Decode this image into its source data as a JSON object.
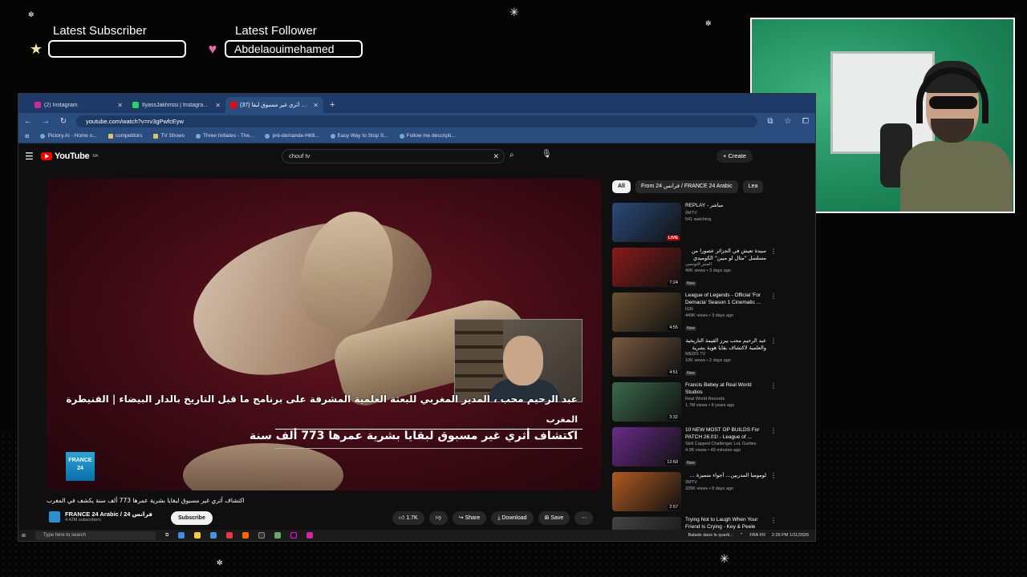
{
  "overlay": {
    "subscriber_label": "Latest Subscriber",
    "subscriber_value": "",
    "follower_label": "Latest Follower",
    "follower_value": "Abdelaouimehamed"
  },
  "browser": {
    "tabs": [
      {
        "title": "(2) Instagram",
        "color": "#d6249f"
      },
      {
        "title": "IlyassJakhrissi | Instagram, Face",
        "color": "#25d366"
      },
      {
        "title": "(37) اكتشاف أثري غير مسبوق لبقا",
        "color": "#ff0000"
      }
    ],
    "url": "youtube.com/watch?v=rv3gPwfcEyw",
    "bookmarks": [
      "Pictory.AI - Home o...",
      "competitors",
      "TV Shows",
      "Three Initiates - The...",
      "pré-demande-H69...",
      "Easy Way to Stop S...",
      "Follow me descripti..."
    ]
  },
  "youtube": {
    "logo": "YouTube",
    "logo_region": "MA",
    "search_query": "chouf tv",
    "create_label": "Create",
    "video": {
      "overlay_line1": "عبد الرحيم محب ، المدير المغربي للبعثة العلمية المشرفة على برنامج ما قبل التاريخ بالدار البيضاء | القنيطرة",
      "overlay_line2": "المغرب",
      "overlay_headline": "اكتشاف أثري غير مسبوق لبقايا بشرية عمرها 773 ألف سنة",
      "logo_text": "FRANCE 24",
      "title": "اكتشاف أثري غير مسبوق لبقايا بشرية عمرها 773 ألف سنة يكشف في المغرب",
      "channel": "FRANCE 24 Arabic / فرانس 24",
      "subscribers": "4.42M subscribers",
      "subscribe": "Subscribe",
      "likes": "1.7K",
      "share": "Share",
      "download": "Download",
      "save": "Save"
    },
    "chips": [
      "All",
      "From فرانس 24 / FRANCE 24 Arabic",
      "Lea"
    ],
    "recommendations": [
      {
        "title": "REPLAY - مباشر",
        "channel": "2MTV",
        "meta": "541 watching",
        "badge": "LIVE",
        "isnew": "",
        "rtl": false,
        "color": "#2b4a7a"
      },
      {
        "title": "سيدة تعيش في الجزائر عصورا من مسلسل \"مثال لو مبين\" الكوميدي لتبدل الحالة ...",
        "channel": "المنبر التونسي",
        "meta": "49K views • 3 days ago",
        "badge": "7:24",
        "isnew": "New",
        "rtl": true,
        "color": "#8a1a1a"
      },
      {
        "title": "League of Legends - Official 'For Demacia' Season 1 Cinematic ...",
        "channel": "IGN",
        "meta": "449K views • 3 days ago",
        "badge": "4:55",
        "isnew": "New",
        "rtl": false,
        "color": "#6a5030"
      },
      {
        "title": "عبد الرحيم محب يبرز القيمة التاريخية والعلمية لاكتشاف بقايا هوية بشرية عمرها ...",
        "channel": "MEDI1 TV",
        "meta": "10K views • 2 days ago",
        "badge": "4:51",
        "isnew": "New",
        "rtl": true,
        "color": "#7a5a40"
      },
      {
        "title": "Francis Bebey at Real World Studios",
        "channel": "Real World Records",
        "meta": "1.7M views • 8 years ago",
        "badge": "3:32",
        "isnew": "",
        "rtl": false,
        "color": "#3a6a4a"
      },
      {
        "title": "10 NEW MOST OP BUILDS For PATCH 26.01! - League of ...",
        "channel": "Skill Capped Challenger LoL Guides",
        "meta": "4.3K views • 49 minutes ago",
        "badge": "12:50",
        "isnew": "New",
        "rtl": false,
        "color": "#6a2a8a"
      },
      {
        "title": "لومومبا المدربين... أجواء متميزة ...",
        "channel": "2MTV",
        "meta": "335K views • 8 days ago",
        "badge": "2:57",
        "isnew": "",
        "rtl": true,
        "color": "#b05a20"
      },
      {
        "title": "Trying Not to Laugh When Your Friend Is Crying - Key & Peele",
        "channel": "",
        "meta": "",
        "badge": "",
        "isnew": "",
        "rtl": false,
        "color": "#444"
      }
    ]
  },
  "taskbar": {
    "search_placeholder": "Type here to search",
    "media": "Balade dans le quarti...",
    "lang": "FRA",
    "lang_sub": "FR",
    "time": "2:26 PM",
    "date": "1/11/2026"
  }
}
